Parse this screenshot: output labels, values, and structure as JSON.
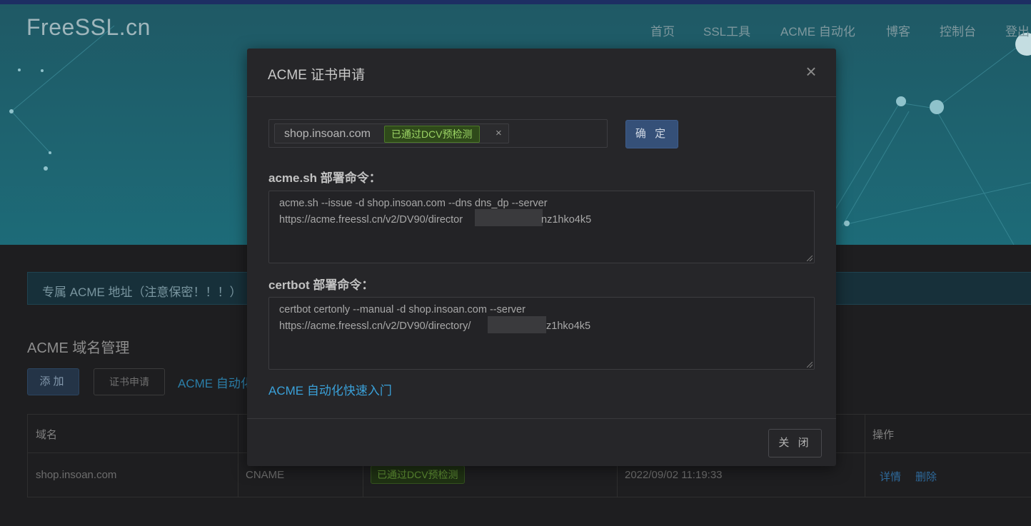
{
  "site": {
    "logo": "FreeSSL.cn",
    "nav": [
      "首页",
      "SSL工具",
      "ACME 自动化",
      "博客",
      "控制台",
      "登出"
    ]
  },
  "page": {
    "alert_text": "专属 ACME 地址（注意保密！！！）",
    "section_title": "ACME 域名管理",
    "buttons": {
      "add": "添加",
      "apply": "证书申请",
      "acme_link": "ACME 自动化"
    },
    "table": {
      "headers": [
        "域名",
        "",
        "",
        "",
        "操作"
      ],
      "rows": [
        {
          "domain": "shop.insoan.com",
          "type": "CNAME",
          "status": "已通过DCV预检测",
          "time": "2022/09/02 11:19:33",
          "actions": [
            "详情",
            "删除"
          ]
        }
      ]
    }
  },
  "modal": {
    "title": "ACME 证书申请",
    "close_icon": "close-icon",
    "domain_tag": {
      "domain": "shop.insoan.com",
      "status": "已通过DCV预检测",
      "remove": "×"
    },
    "confirm_label": "确 定",
    "acme_sh": {
      "label": "acme.sh 部署命令：",
      "line1": "acme.sh --issue -d shop.insoan.com  --dns dns_dp --server",
      "line2_prefix": "https://acme.freessl.cn/v2/DV90/director",
      "line2_suffix": "nz1hko4k5"
    },
    "certbot": {
      "label": "certbot 部署命令：",
      "line1": "certbot certonly --manual -d shop.insoan.com  --server",
      "line2_prefix": "https://acme.freessl.cn/v2/DV90/directory/",
      "line2_suffix": "z1hko4k5"
    },
    "quickstart_link": "ACME 自动化快速入门",
    "close_button": "关 闭"
  },
  "colors": {
    "accent_link": "#3aa0d8",
    "success_badge": "#9cd565",
    "primary_button": "#355078"
  }
}
